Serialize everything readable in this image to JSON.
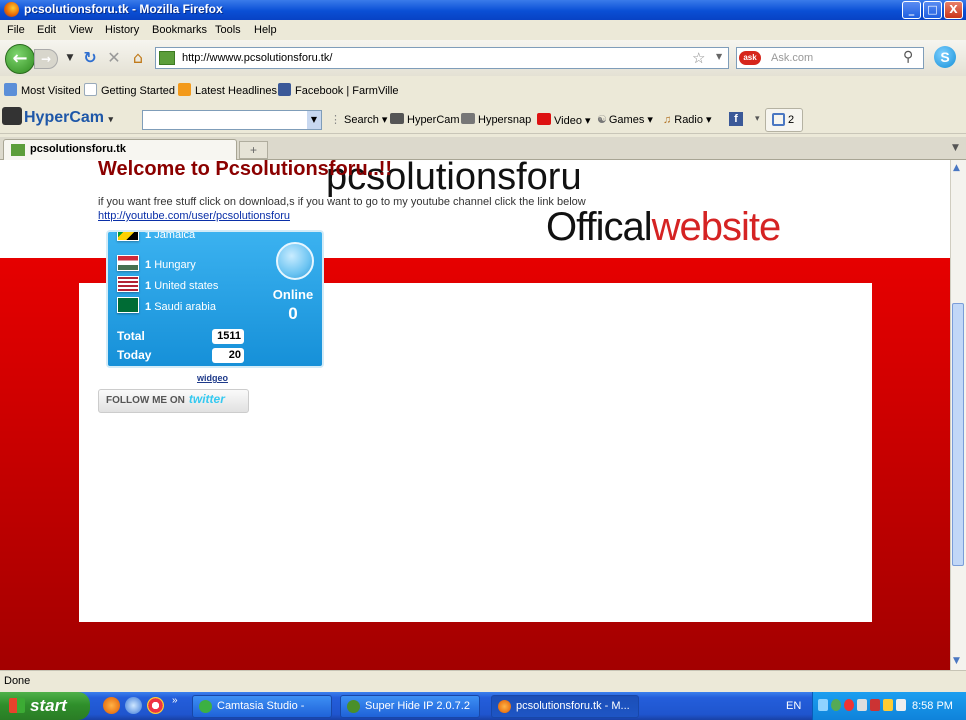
{
  "window": {
    "title": "pcsolutionsforu.tk - Mozilla Firefox",
    "controls": [
      "_",
      "□",
      "X"
    ]
  },
  "menu": [
    "File",
    "Edit",
    "View",
    "History",
    "Bookmarks",
    "Tools",
    "Help"
  ],
  "nav": {
    "url": "http://wwww.pcsolutionsforu.tk/",
    "search_placeholder": "Ask.com"
  },
  "bookmarks": [
    "Most Visited",
    "Getting Started",
    "Latest Headlines",
    "Facebook | FarmVille"
  ],
  "hypercam_toolbar": {
    "logo": "HyperCam",
    "items": [
      "Search",
      "HyperCam",
      "Hypersnap",
      "Video",
      "Games",
      "Radio"
    ],
    "count": "2"
  },
  "tab": {
    "label": "pcsolutionsforu.tk",
    "new_tab": "+"
  },
  "page": {
    "header_line1": "pcsolutionsforu",
    "header_line2_a": "Offical",
    "header_line2_b": "website",
    "welcome": "Welcome to Pcsolutionsforu..!!",
    "intro": "if you want free stuff click on download,s if you want to go to my youtube channel click the link below",
    "youtube_link": "http://youtube.com/user/pcsolutionsforu",
    "widget": {
      "countries": [
        {
          "count": "1",
          "name": "Jamaica"
        },
        {
          "count": "1",
          "name": "Hungary"
        },
        {
          "count": "1",
          "name": "United states"
        },
        {
          "count": "1",
          "name": "Saudi arabia"
        }
      ],
      "online_label": "Online",
      "online_value": "0",
      "total_label": "Total",
      "total_value": "1511",
      "today_label": "Today",
      "today_value": "20"
    },
    "widgeo": "widgeo",
    "twitter_a": "FOLLOW ME ON",
    "twitter_b": "twitter"
  },
  "status": "Done",
  "taskbar": {
    "start": "start",
    "tasks": [
      "Camtasia Studio - Unt...",
      "Super Hide IP  2.0.7.2",
      "pcsolutionsforu.tk - M..."
    ],
    "lang": "EN",
    "clock": "8:58 PM"
  }
}
